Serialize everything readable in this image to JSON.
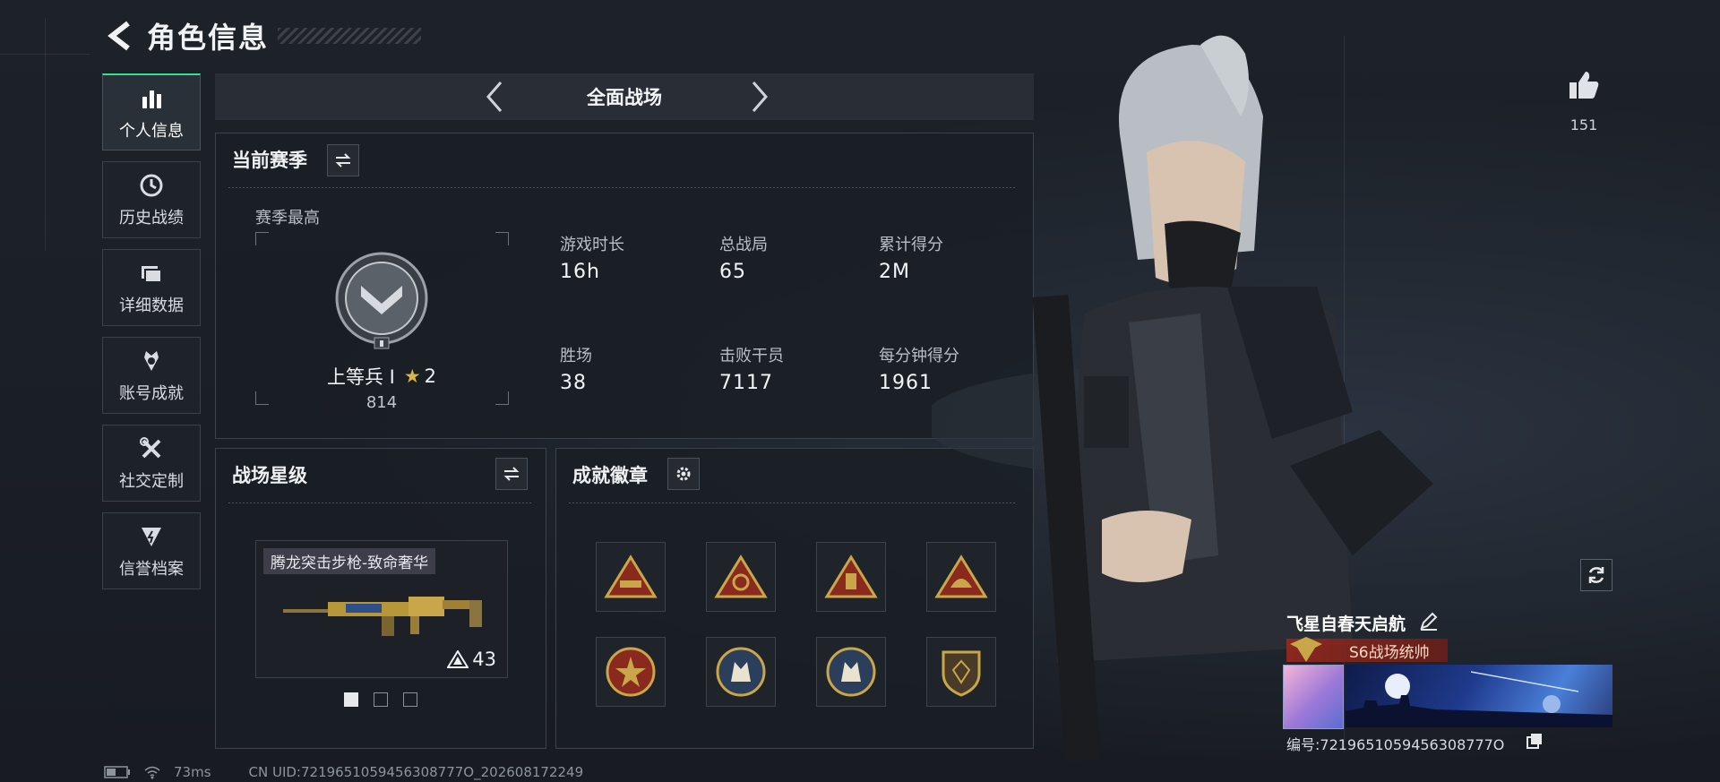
{
  "header": {
    "title": "角色信息"
  },
  "sidebar": {
    "items": [
      {
        "label": "个人信息",
        "icon": "bar-chart-icon",
        "active": true
      },
      {
        "label": "历史战绩",
        "icon": "history-clock-icon"
      },
      {
        "label": "详细数据",
        "icon": "folder-icon"
      },
      {
        "label": "账号成就",
        "icon": "achievement-medal-icon"
      },
      {
        "label": "社交定制",
        "icon": "tools-icon"
      },
      {
        "label": "信誉档案",
        "icon": "shield-lightning-icon"
      }
    ]
  },
  "mode_bar": {
    "title": "全面战场"
  },
  "season": {
    "title": "当前赛季",
    "best_label": "赛季最高",
    "rank_name": "上等兵 I",
    "rank_stars": "2",
    "rank_points": "814",
    "stats": [
      {
        "label": "游戏时长",
        "value": "16h"
      },
      {
        "label": "总战局",
        "value": "65"
      },
      {
        "label": "累计得分",
        "value": "2M"
      },
      {
        "label": "胜场",
        "value": "38"
      },
      {
        "label": "击败干员",
        "value": "7117"
      },
      {
        "label": "每分钟得分",
        "value": "1961"
      }
    ]
  },
  "star_level": {
    "title": "战场星级",
    "weapon_name": "腾龙突击步枪-致命奢华",
    "weapon_level": "43"
  },
  "achievements": {
    "title": "成就徽章",
    "badges": [
      "tank-badge-icon",
      "radar-badge-icon",
      "tower-badge-icon",
      "helmet-badge-icon",
      "star-badge-icon",
      "wolf-badge-icon",
      "wolf-badge-2-icon",
      "shield-badge-icon"
    ]
  },
  "profile": {
    "likes": "151",
    "name": "飞星自春天启航",
    "rank_tag": "S6战场统帅",
    "id_text": "编号:7219651059456308777O"
  },
  "footer": {
    "ping": "73ms",
    "uid": "CN UID:7219651059456308777O_202608172249"
  },
  "colors": {
    "accent": "#39e08a",
    "gold": "#c9a64a",
    "bg": "#1b1f26"
  }
}
